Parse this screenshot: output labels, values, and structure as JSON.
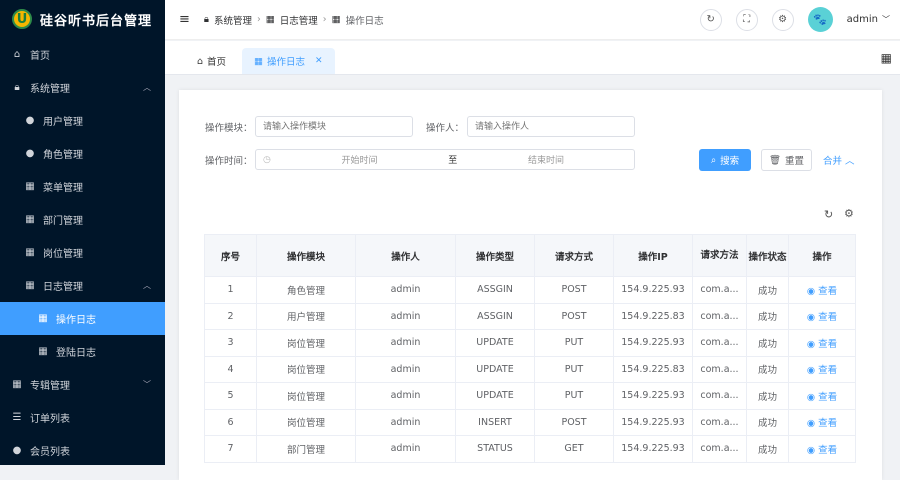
{
  "app": {
    "title": "硅谷听书后台管理",
    "logo_letter": "U"
  },
  "sidebar": {
    "items": [
      {
        "label": "首页",
        "icon": "home-icon"
      },
      {
        "label": "系统管理",
        "icon": "lock-icon"
      },
      {
        "label": "用户管理",
        "icon": "user-icon"
      },
      {
        "label": "角色管理",
        "icon": "user-icon"
      },
      {
        "label": "菜单管理",
        "icon": "grid-icon"
      },
      {
        "label": "部门管理",
        "icon": "grid-icon"
      },
      {
        "label": "岗位管理",
        "icon": "grid-icon"
      },
      {
        "label": "日志管理",
        "icon": "grid-icon"
      },
      {
        "label": "操作日志",
        "icon": "grid-icon"
      },
      {
        "label": "登陆日志",
        "icon": "grid-icon"
      },
      {
        "label": "专辑管理",
        "icon": "grid-icon"
      },
      {
        "label": "订单列表",
        "icon": "list-icon"
      },
      {
        "label": "会员列表",
        "icon": "user-icon"
      }
    ]
  },
  "header": {
    "breadcrumb": [
      "系统管理",
      "日志管理",
      "操作日志"
    ],
    "user": "admin"
  },
  "tabs": [
    {
      "label": "首页"
    },
    {
      "label": "操作日志"
    }
  ],
  "search": {
    "module_label": "操作模块：",
    "module_placeholder": "请输入操作模块",
    "operator_label": "操作人：",
    "operator_placeholder": "请输入操作人",
    "time_label": "操作时间：",
    "start_placeholder": "开始时间",
    "range_sep": "至",
    "end_placeholder": "结束时间",
    "search_btn": "搜索",
    "reset_btn": "重置",
    "collapse_link": "合并"
  },
  "table": {
    "headers": [
      "序号",
      "操作模块",
      "操作人",
      "操作类型",
      "请求方式",
      "操作IP",
      "请求方法",
      "操作状态",
      "操作"
    ],
    "rows": [
      [
        "1",
        "角色管理",
        "admin",
        "ASSGIN",
        "POST",
        "154.9.225.93",
        "com.a...",
        "成功",
        "查看"
      ],
      [
        "2",
        "用户管理",
        "admin",
        "ASSGIN",
        "POST",
        "154.9.225.83",
        "com.a...",
        "成功",
        "查看"
      ],
      [
        "3",
        "岗位管理",
        "admin",
        "UPDATE",
        "PUT",
        "154.9.225.93",
        "com.a...",
        "成功",
        "查看"
      ],
      [
        "4",
        "岗位管理",
        "admin",
        "UPDATE",
        "PUT",
        "154.9.225.83",
        "com.a...",
        "成功",
        "查看"
      ],
      [
        "5",
        "岗位管理",
        "admin",
        "UPDATE",
        "PUT",
        "154.9.225.93",
        "com.a...",
        "成功",
        "查看"
      ],
      [
        "6",
        "岗位管理",
        "admin",
        "INSERT",
        "POST",
        "154.9.225.93",
        "com.a...",
        "成功",
        "查看"
      ],
      [
        "7",
        "部门管理",
        "admin",
        "STATUS",
        "GET",
        "154.9.225.93",
        "com.a...",
        "成功",
        "查看"
      ]
    ]
  }
}
